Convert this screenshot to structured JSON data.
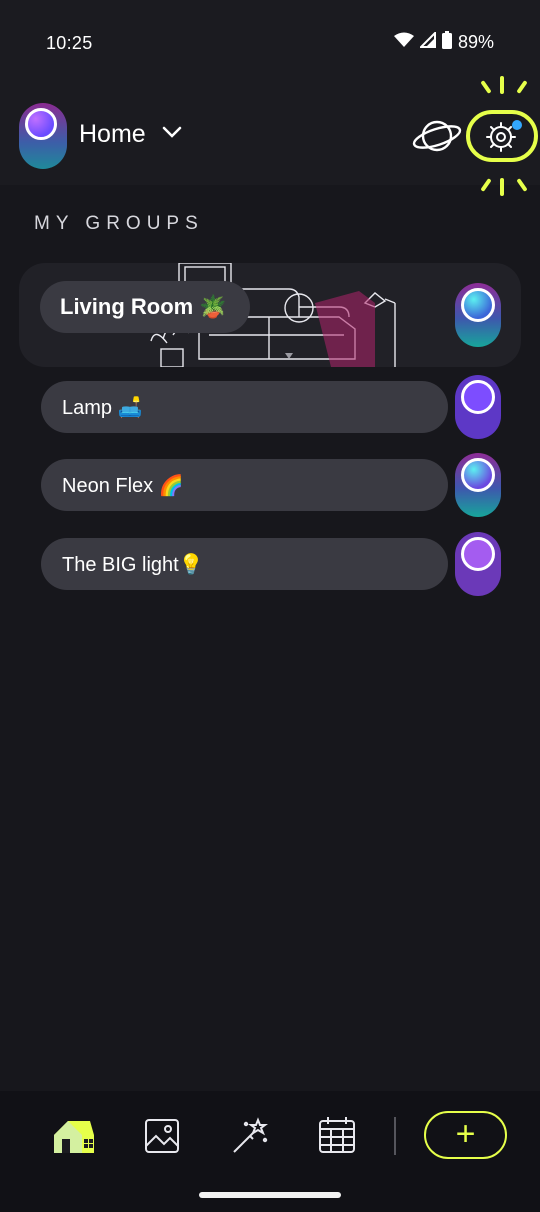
{
  "status": {
    "time": "10:25",
    "battery": "89%"
  },
  "header": {
    "title": "Home",
    "brand_color": "#e6ff4a"
  },
  "section": {
    "title": "MY GROUPS"
  },
  "room": {
    "label": "Living Room 🪴"
  },
  "lights": [
    {
      "label": "Lamp 🛋️"
    },
    {
      "label": "Neon Flex 🌈"
    },
    {
      "label": "The BIG light💡"
    }
  ],
  "nav": {
    "items": [
      "home-icon",
      "gallery-icon",
      "effects-wand-icon",
      "schedule-calendar-icon"
    ],
    "add_label": "+"
  }
}
